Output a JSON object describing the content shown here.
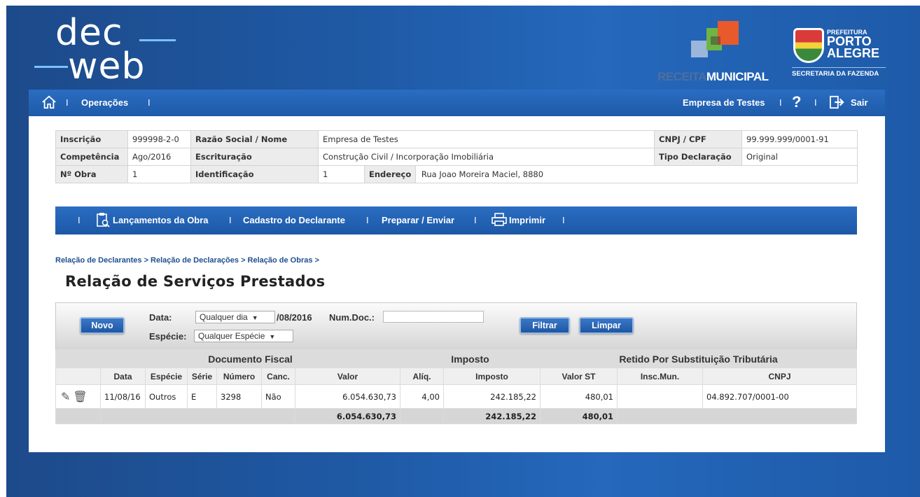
{
  "header": {
    "logo_line1": "dec",
    "logo_line2": "web",
    "receita_part1": "RECEITA",
    "receita_part2": "MUNICIPAL",
    "prefeitura_small": "PREFEITURA",
    "prefeitura_line1": "PORTO",
    "prefeitura_line2": "ALEGRE",
    "secretaria": "SECRETARIA DA FAZENDA"
  },
  "topnav": {
    "operacoes": "Operações",
    "empresa": "Empresa de Testes",
    "sair": "Sair",
    "sep": "I"
  },
  "info": {
    "inscricao_label": "Inscrição",
    "inscricao": "999998-2-0",
    "razao_label": "Razão Social / Nome",
    "razao": "Empresa de Testes",
    "cnpj_label": "CNPJ / CPF",
    "cnpj": "99.999.999/0001-91",
    "competencia_label": "Competência",
    "competencia": "Ago/2016",
    "escrituracao_label": "Escrituração",
    "escrituracao": "Construção Civil / Incorporação Imobiliária",
    "tipo_label": "Tipo Declaração",
    "tipo": "Original",
    "obra_label": "Nº Obra",
    "obra": "1",
    "identificacao_label": "Identificação",
    "identificacao": "1",
    "endereco_label": "Endereço",
    "endereco": "Rua Joao Moreira Maciel, 8880"
  },
  "obranav": {
    "lancamentos": "Lançamentos da Obra",
    "cadastro": "Cadastro do Declarante",
    "preparar": "Preparar / Enviar",
    "imprimir": "Imprimir"
  },
  "breadcrumb": "Relação de Declarantes > Relação de Declarações > Relação de Obras >",
  "page_title": "Relação de Serviços Prestados",
  "filter": {
    "novo": "Novo",
    "data_label": "Data:",
    "data_select": "Qualquer dia",
    "data_suffix": "/08/2016",
    "numdoc_label": "Num.Doc.:",
    "numdoc_value": "",
    "especie_label": "Espécie:",
    "especie_select": "Qualquer Espécie",
    "filtrar": "Filtrar",
    "limpar": "Limpar"
  },
  "table": {
    "group_doc": "Documento Fiscal",
    "group_imposto": "Imposto",
    "group_retido": "Retido Por Substituição Tributária",
    "columns": [
      "Data",
      "Espécie",
      "Série",
      "Número",
      "Canc.",
      "Valor",
      "Alíq.",
      "Imposto",
      "Valor ST",
      "Insc.Mun.",
      "CNPJ"
    ],
    "rows": [
      {
        "data": "11/08/16",
        "especie": "Outros",
        "serie": "E",
        "numero": "3298",
        "canc": "Não",
        "valor": "6.054.630,73",
        "aliq": "4,00",
        "imposto": "242.185,22",
        "valor_st": "480,01",
        "insc_mun": "",
        "cnpj": "04.892.707/0001-00"
      }
    ],
    "total": {
      "valor": "6.054.630,73",
      "imposto": "242.185,22",
      "valor_st": "480,01"
    }
  },
  "colors": {
    "brand_blue": "#1e5aa8",
    "nav_blue": "#2a6dc2"
  }
}
